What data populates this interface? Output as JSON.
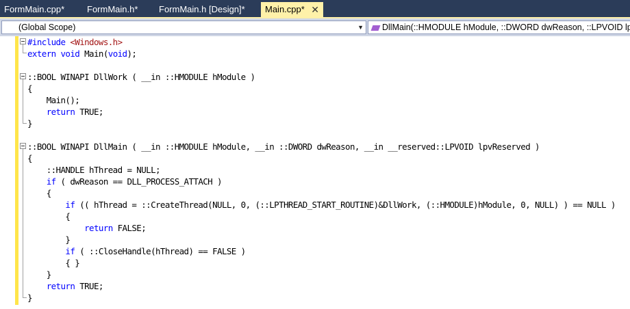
{
  "tabs": [
    {
      "label": "FormMain.cpp*",
      "active": false
    },
    {
      "label": "FormMain.h*",
      "active": false
    },
    {
      "label": "FormMain.h [Design]*",
      "active": false
    },
    {
      "label": "Main.cpp*",
      "active": true
    }
  ],
  "tab_close_glyph": "✕",
  "navbar": {
    "scope": "(Global Scope)",
    "member": "DllMain(::HMODULE hModule, ::DWORD dwReason, ::LPVOID lpvReserved)"
  },
  "colors": {
    "tabbar_bg": "#2b3c59",
    "active_tab": "#fff1a9",
    "keyword": "#0000ff",
    "string": "#a31515",
    "change_marker": "#ffe54a"
  },
  "code": {
    "l1_include": "#include",
    "l1_header": "<Windows.h>",
    "l2_extern": "extern",
    "l2_void": "void",
    "l2_rest1": " Main(",
    "l2_void2": "void",
    "l2_rest2": ");",
    "l4": "::BOOL WINAPI DllWork ( __in ::HMODULE hModule )",
    "l5": "{",
    "l6": "    Main();",
    "l7_ret": "return",
    "l7_rest": " TRUE;",
    "l8": "}",
    "l10": "::BOOL WINAPI DllMain ( __in ::HMODULE hModule, __in ::DWORD dwReason, __in __reserved::LPVOID lpvReserved )",
    "l11": "{",
    "l12": "    ::HANDLE hThread = NULL;",
    "l13_if": "if",
    "l13_rest": " ( dwReason == DLL_PROCESS_ATTACH )",
    "l14": "    {",
    "l15_if": "if",
    "l15_rest": " (( hThread = ::CreateThread(NULL, 0, (::LPTHREAD_START_ROUTINE)&DllWork, (::HMODULE)hModule, 0, NULL) ) == NULL )",
    "l16": "        {",
    "l17_ret": "return",
    "l17_rest": " FALSE;",
    "l18": "        }",
    "l19_if": "if",
    "l19_rest": " ( ::CloseHandle(hThread) == FALSE )",
    "l20": "        { }",
    "l21": "    }",
    "l22_ret": "return",
    "l22_rest": " TRUE;",
    "l23": "}"
  }
}
